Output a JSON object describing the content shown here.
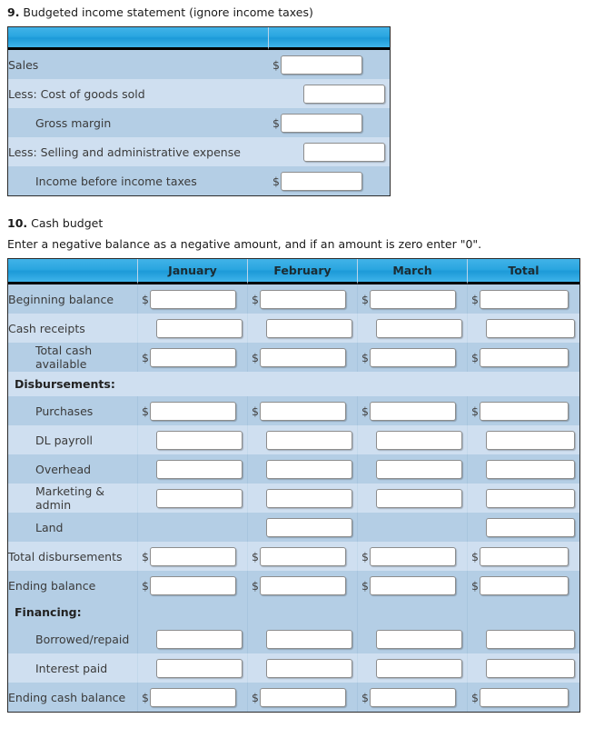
{
  "income_statement": {
    "number": "9.",
    "title": " Budgeted income statement (ignore income taxes)",
    "headers": [
      "",
      ""
    ],
    "rows": [
      {
        "label": "Sales",
        "indent": false,
        "dollar": true,
        "value": ""
      },
      {
        "label": "Less: Cost of goods sold",
        "indent": false,
        "dollar": false,
        "value": ""
      },
      {
        "label": "Gross margin",
        "indent": true,
        "dollar": true,
        "value": ""
      },
      {
        "label": "Less: Selling and administrative expense",
        "indent": false,
        "dollar": false,
        "value": ""
      },
      {
        "label": "Income before income taxes",
        "indent": true,
        "dollar": true,
        "value": ""
      }
    ]
  },
  "cash_budget": {
    "number": "10.",
    "title": " Cash budget",
    "instruction": "Enter a negative balance as a negative amount, and if an amount is zero enter \"0\".",
    "headers": [
      "",
      "January",
      "February",
      "March",
      "Total"
    ],
    "rows": [
      {
        "label": "Beginning balance",
        "type": "data",
        "indent": false,
        "dollar": true,
        "cells": [
          "",
          "",
          "",
          ""
        ]
      },
      {
        "label": "Cash receipts",
        "type": "data",
        "indent": false,
        "dollar": false,
        "cells": [
          "",
          "",
          "",
          ""
        ]
      },
      {
        "label": "Total cash available",
        "type": "data",
        "indent": true,
        "wrap": true,
        "dollar": true,
        "cells": [
          "",
          "",
          "",
          ""
        ]
      },
      {
        "label": "Disbursements:",
        "type": "section",
        "bold": true
      },
      {
        "label": "Purchases",
        "type": "data",
        "indent": true,
        "dollar": true,
        "cells": [
          "",
          "",
          "",
          ""
        ]
      },
      {
        "label": "DL payroll",
        "type": "data",
        "indent": true,
        "dollar": false,
        "cells": [
          "",
          "",
          "",
          ""
        ]
      },
      {
        "label": "Overhead",
        "type": "data",
        "indent": true,
        "dollar": false,
        "cells": [
          "",
          "",
          "",
          ""
        ]
      },
      {
        "label": "Marketing & admin",
        "type": "data",
        "indent": true,
        "wrap": true,
        "dollar": false,
        "cells": [
          "",
          "",
          "",
          ""
        ]
      },
      {
        "label": "Land",
        "type": "data",
        "indent": true,
        "dollar": false,
        "cells": [
          null,
          "",
          null,
          ""
        ]
      },
      {
        "label": "Total disbursements",
        "type": "data",
        "indent": false,
        "dollar": true,
        "cells": [
          "",
          "",
          "",
          ""
        ]
      },
      {
        "label": "Ending balance",
        "type": "data",
        "indent": false,
        "dollar": true,
        "cells": [
          "",
          "",
          "",
          ""
        ]
      },
      {
        "label": "Financing:",
        "type": "subheader",
        "bold": true
      },
      {
        "label": "Borrowed/repaid",
        "type": "data",
        "indent": true,
        "dollar": false,
        "cells": [
          "",
          "",
          "",
          ""
        ]
      },
      {
        "label": "Interest paid",
        "type": "data",
        "indent": true,
        "dollar": false,
        "cells": [
          "",
          "",
          "",
          ""
        ]
      },
      {
        "label": "Ending cash balance",
        "type": "data",
        "indent": false,
        "dollar": true,
        "cells": [
          "",
          "",
          "",
          ""
        ]
      }
    ]
  },
  "colors": {
    "header_blue": "#2aa6e0",
    "row_dark": "#b4cee5",
    "row_light": "#cfdff0",
    "table_border": "#2b2b2b"
  }
}
